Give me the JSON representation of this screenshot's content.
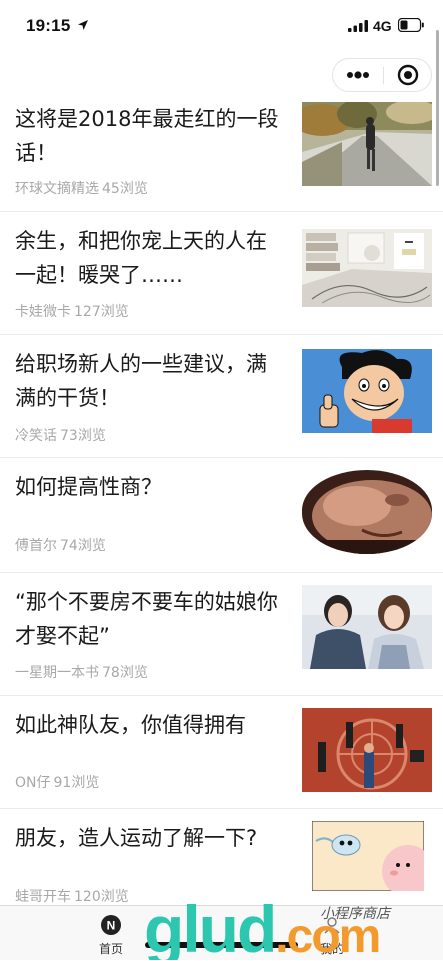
{
  "status_bar": {
    "time": "19:15",
    "network": "4G"
  },
  "articles": [
    {
      "title": "这将是2018年最走红的一段话！",
      "source": "环球文摘精选",
      "views": "45浏览",
      "image": "path-walker-photo"
    },
    {
      "title": "余生，和把你宠上天的人在一起！暖哭了……",
      "source": "卡娃微卡",
      "views": "127浏览",
      "image": "books-flowers-photo"
    },
    {
      "title": "给职场新人的一些建议，满满的干货！",
      "source": "冷笑话",
      "views": "73浏览",
      "image": "cartoon-thumbs-up"
    },
    {
      "title": "如何提高性商？",
      "source": "傅首尔",
      "views": "74浏览",
      "image": "closeup-face-photo"
    },
    {
      "title": "“那个不要房不要车的姑娘你才娶不起”",
      "source": "一星期一本书",
      "views": "78浏览",
      "image": "couple-photo"
    },
    {
      "title": "如此神队友，你值得拥有",
      "source": "ON仔",
      "views": "91浏览",
      "image": "red-ground-people-photo"
    },
    {
      "title": "朋友，造人运动了解一下?",
      "source": "蛙哥开车",
      "views": "120浏览",
      "image": "cartoon-sperm-egg"
    }
  ],
  "tabbar": {
    "tabs": [
      {
        "label": "首页",
        "icon_letter": "N"
      },
      {
        "label": "我的"
      }
    ]
  },
  "watermark": {
    "text": "glud.com",
    "subtext": "小程序商店"
  },
  "colors": {
    "meta_gray": "#a8a8a8",
    "divider": "#ebebeb",
    "watermark_teal": "#2dc7b0",
    "watermark_orange": "#f39a2e"
  }
}
